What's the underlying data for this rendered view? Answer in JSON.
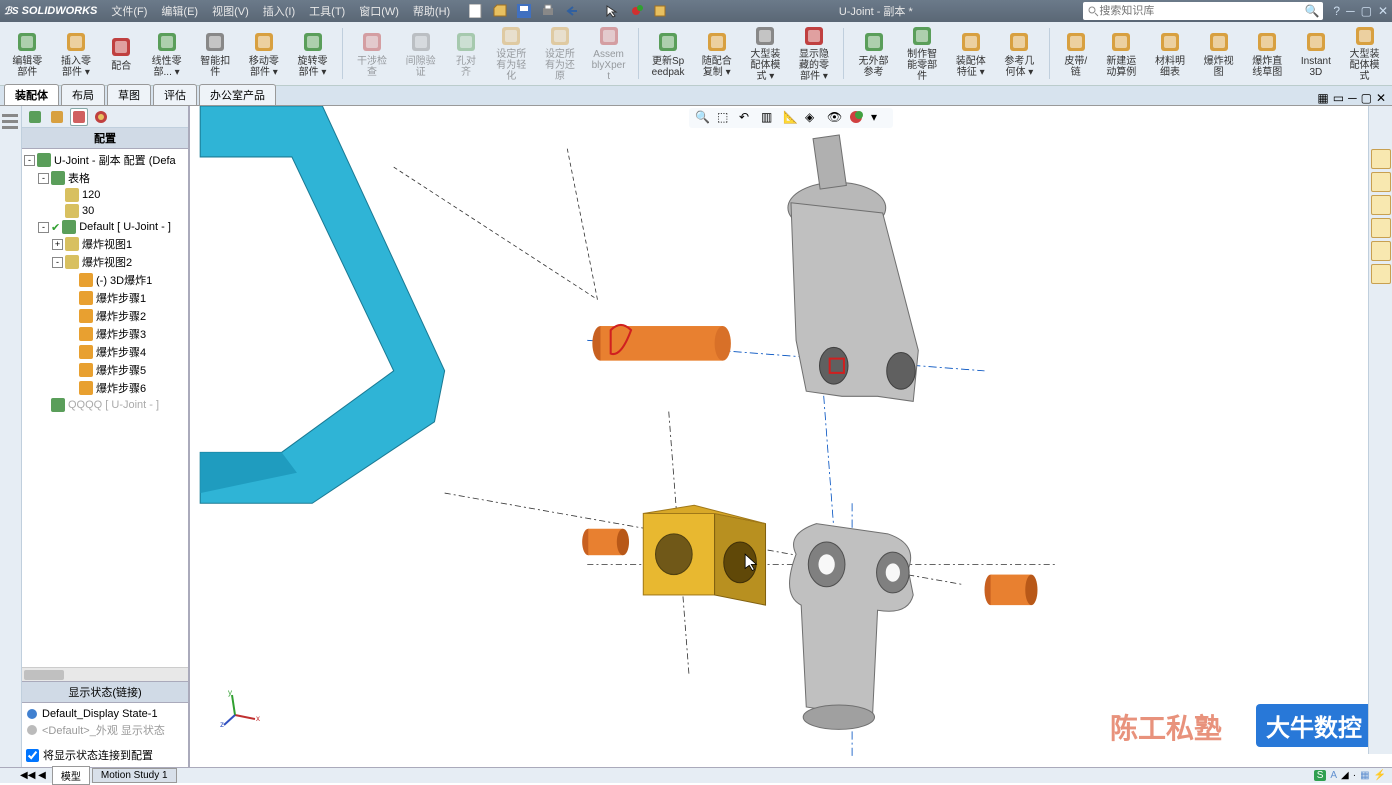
{
  "app": {
    "logo": "SOLIDWORKS",
    "doc_title": "U-Joint - 副本 *"
  },
  "menu": [
    "文件(F)",
    "编辑(E)",
    "视图(V)",
    "插入(I)",
    "工具(T)",
    "窗口(W)",
    "帮助(H)"
  ],
  "search": {
    "placeholder": "搜索知识库"
  },
  "ribbon": [
    {
      "label": "编辑零部件",
      "icon": "edit-part"
    },
    {
      "label": "插入零部件",
      "icon": "insert-part",
      "dd": true
    },
    {
      "label": "配合",
      "icon": "mate"
    },
    {
      "label": "线性零部...",
      "icon": "linear-pattern",
      "dd": true
    },
    {
      "label": "智能扣件",
      "icon": "smart-fastener"
    },
    {
      "label": "移动零部件",
      "icon": "move-comp",
      "dd": true
    },
    {
      "label": "旋转零部件",
      "icon": "show-hidden",
      "dd": true
    },
    {
      "label": "干涉检查",
      "icon": "interference",
      "disabled": true
    },
    {
      "label": "间隙验证",
      "icon": "clearance",
      "disabled": true
    },
    {
      "label": "孔对齐",
      "icon": "hole-align",
      "disabled": true
    },
    {
      "label": "设定所有为轻化",
      "icon": "assy-vis",
      "disabled": true
    },
    {
      "label": "设定所有为还原",
      "icon": "assy-vis",
      "disabled": true
    },
    {
      "label": "AssemblyXpert",
      "icon": "assy-xpert",
      "disabled": true
    },
    {
      "label": "更新Speedpak",
      "icon": "perf-eval"
    },
    {
      "label": "随配合复制",
      "icon": "new-motion",
      "dd": true
    },
    {
      "label": "大型装配体模式",
      "icon": "bom",
      "dd": true
    },
    {
      "label": "显示隐藏的零部件",
      "icon": "exploded",
      "dd": true
    },
    {
      "label": "无外部参考",
      "icon": "instant3d"
    },
    {
      "label": "制作智能零部件",
      "icon": "instant3d"
    },
    {
      "label": "装配体特征",
      "icon": "large-assy",
      "dd": true
    },
    {
      "label": "参考几何体",
      "icon": "large-assy",
      "dd": true
    },
    {
      "label": "皮带/链",
      "icon": "large-assy"
    },
    {
      "label": "新建运动算例",
      "icon": "large-assy"
    },
    {
      "label": "材料明细表",
      "icon": "large-assy"
    },
    {
      "label": "爆炸视图",
      "icon": "large-assy"
    },
    {
      "label": "爆炸直线草图",
      "icon": "large-assy"
    },
    {
      "label": "Instant3D",
      "icon": "large-assy"
    },
    {
      "label": "大型装配体模式",
      "icon": "large-assy"
    }
  ],
  "cmd_tabs": [
    "装配体",
    "布局",
    "草图",
    "评估",
    "办公室产品"
  ],
  "feature_panel": {
    "header": "配置",
    "root": "U-Joint - 副本 配置  (Defa",
    "items": [
      {
        "level": 1,
        "exp": "-",
        "icon": "cfg",
        "label": "表格"
      },
      {
        "level": 2,
        "icon": "dim",
        "label": "120"
      },
      {
        "level": 2,
        "icon": "dim",
        "label": "30"
      },
      {
        "level": 1,
        "exp": "-",
        "icon": "cfg",
        "label": "Default [ U-Joint - ]",
        "check": true
      },
      {
        "level": 2,
        "exp": "+",
        "icon": "exp",
        "label": "爆炸视图1"
      },
      {
        "level": 2,
        "exp": "-",
        "icon": "exp",
        "label": "爆炸视图2"
      },
      {
        "level": 3,
        "icon": "step",
        "label": "(-) 3D爆炸1"
      },
      {
        "level": 3,
        "icon": "step",
        "label": "爆炸步骤1"
      },
      {
        "level": 3,
        "icon": "step",
        "label": "爆炸步骤2"
      },
      {
        "level": 3,
        "icon": "step",
        "label": "爆炸步骤3"
      },
      {
        "level": 3,
        "icon": "step",
        "label": "爆炸步骤4"
      },
      {
        "level": 3,
        "icon": "step",
        "label": "爆炸步骤5"
      },
      {
        "level": 3,
        "icon": "step",
        "label": "爆炸步骤6"
      },
      {
        "level": 1,
        "icon": "cfg",
        "label": "QQQQ [ U-Joint - ]",
        "gray": true
      }
    ],
    "display_header": "显示状态(链接)",
    "display_states": [
      {
        "label": "Default_Display State-1",
        "active": true
      },
      {
        "label": "<Default>_外观 显示状态",
        "gray": true
      }
    ],
    "checkbox": "将显示状态连接到配置"
  },
  "bottom_tabs": [
    "模型",
    "Motion Study 1"
  ],
  "watermark1": "陈工私塾",
  "watermark2": "大牛数控"
}
